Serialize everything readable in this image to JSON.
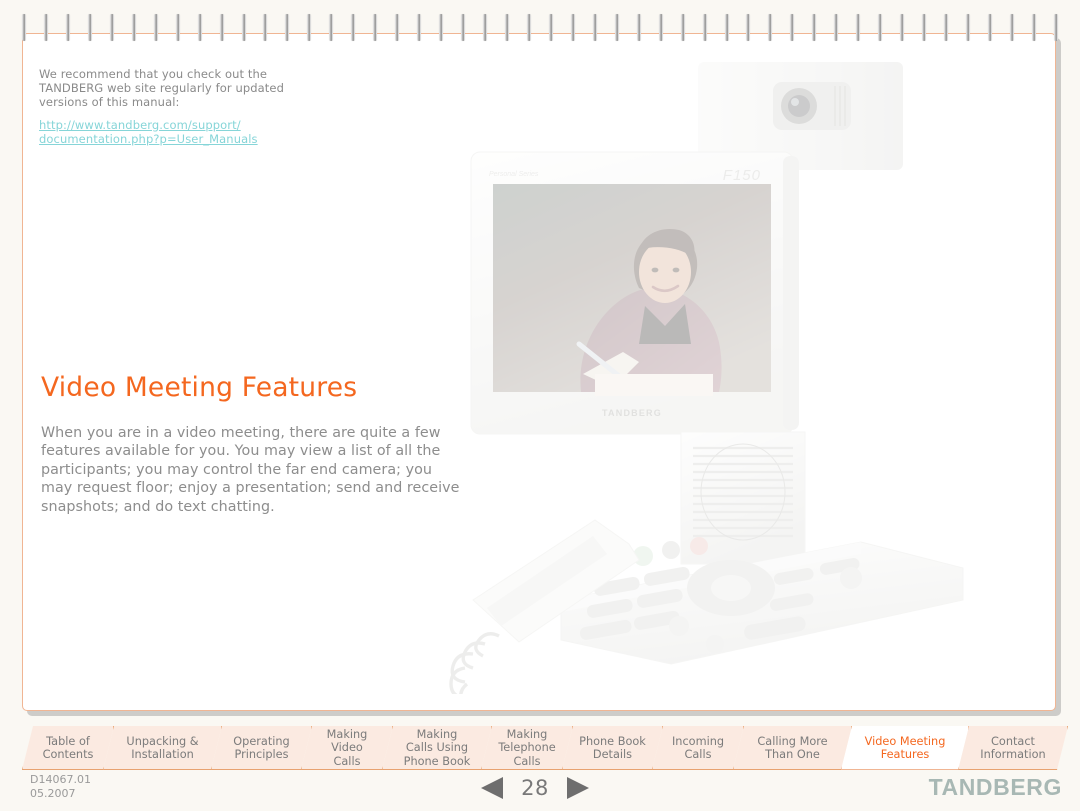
{
  "note": {
    "lines": [
      "We recommend that you check out the",
      "TANDBERG web site regularly for updated",
      "versions of this manual:"
    ],
    "link_lines": [
      "http://www.tandberg.com/support/",
      "documentation.php?p=User_Manuals"
    ],
    "link_color": "#86d5d8"
  },
  "heading": "Video Meeting Features",
  "body_lines": [
    "When you are in a video meeting, there are quite a few",
    "features available for you. You may view a list of all the",
    "participants; you may control the far end camera; you",
    "may request floor; enjoy a presentation; send and receive",
    "snapshots; and do text chatting."
  ],
  "photo": {
    "device_brand": "TANDBERG",
    "device_model": "F150",
    "device_series": "Personal Series"
  },
  "tabs": [
    {
      "label": "Table of\nContents",
      "active": false
    },
    {
      "label": "Unpacking &\nInstallation",
      "active": false
    },
    {
      "label": "Operating\nPrinciples",
      "active": false
    },
    {
      "label": "Making\nVideo\nCalls",
      "active": false
    },
    {
      "label": "Making\nCalls Using\nPhone Book",
      "active": false
    },
    {
      "label": "Making\nTelephone\nCalls",
      "active": false
    },
    {
      "label": "Phone Book\nDetails",
      "active": false
    },
    {
      "label": "Incoming\nCalls",
      "active": false
    },
    {
      "label": "Calling More\nThan One",
      "active": false
    },
    {
      "label": "Video Meeting\nFeatures",
      "active": true
    },
    {
      "label": "Contact\nInformation",
      "active": false
    }
  ],
  "footer": {
    "doc_id": "D14067.01",
    "doc_date": "05.2007",
    "page_number": "28",
    "prev_icon": "left-triangle-icon",
    "next_icon": "right-triangle-icon",
    "brand": "TANDBERG"
  },
  "colors": {
    "accent_orange": "#f4671f",
    "tab_fill": "#fbeae1",
    "tab_border": "#e8a270",
    "page_border": "#f0b593",
    "body_text": "#8d8d8d",
    "canvas": "#faf8f3"
  },
  "binding": {
    "ring_count": 48,
    "icon": "spiral-ring-icon"
  }
}
